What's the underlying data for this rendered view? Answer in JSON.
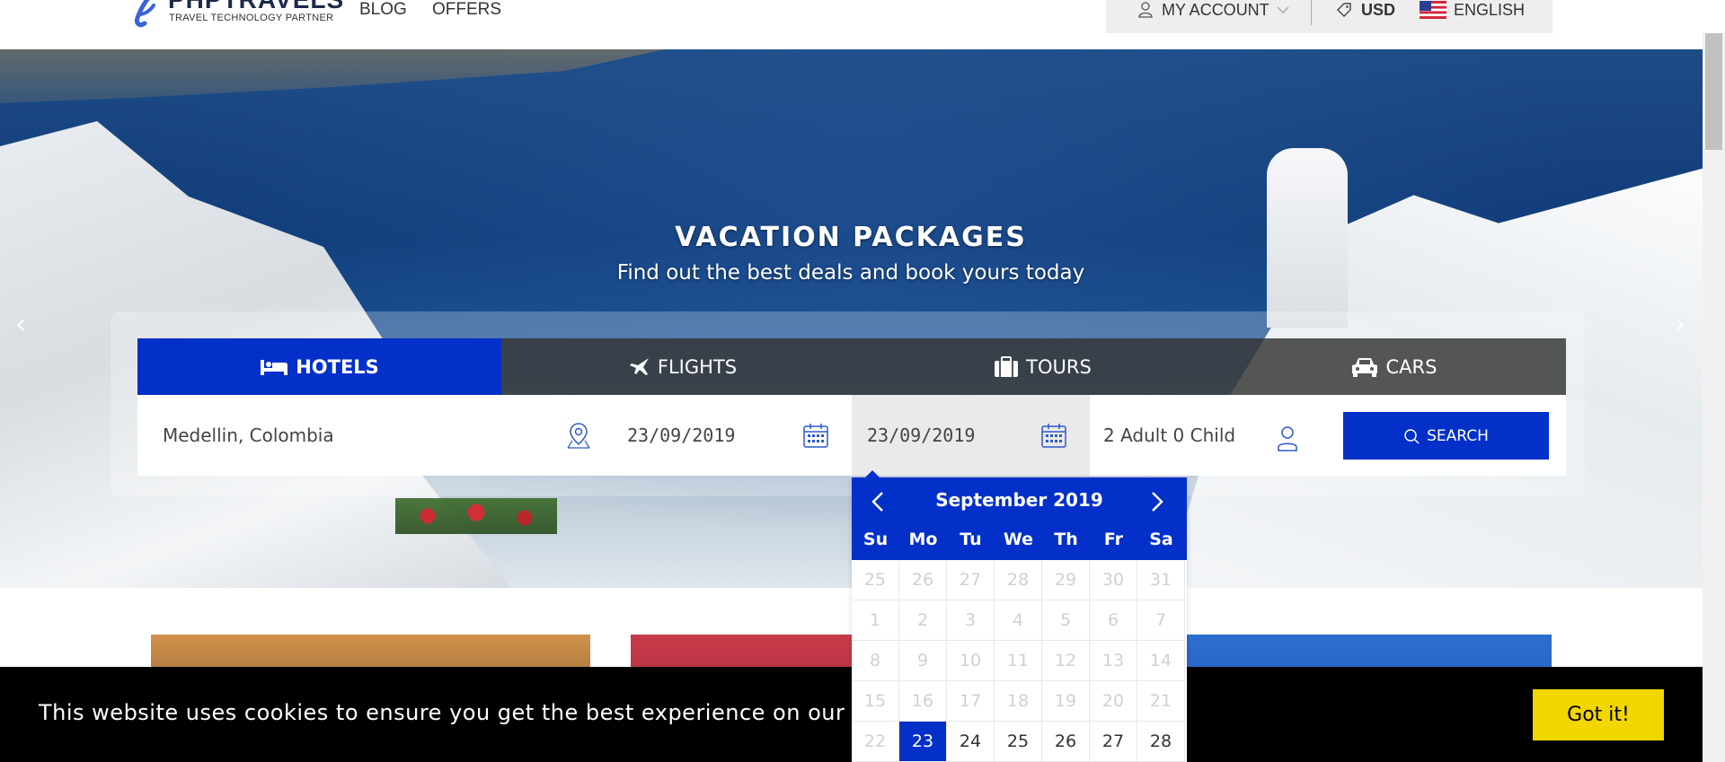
{
  "brand": {
    "name": "PHPTRAVELS",
    "tagline": "TRAVEL TECHNOLOGY PARTNER",
    "accent_color": "#0330c8"
  },
  "nav": {
    "links": [
      "BLOG",
      "OFFERS"
    ]
  },
  "account_bar": {
    "account_label": "MY ACCOUNT",
    "currency": "USD",
    "language": "ENGLISH"
  },
  "hero": {
    "title": "VACATION PACKAGES",
    "subtitle": "Find out the best deals and book yours today",
    "prev_arrow": "‹",
    "next_arrow": "›"
  },
  "search": {
    "tabs": [
      {
        "label": "HOTELS",
        "icon": "bed-icon",
        "active": true
      },
      {
        "label": "FLIGHTS",
        "icon": "plane-icon",
        "active": false
      },
      {
        "label": "TOURS",
        "icon": "suitcase-icon",
        "active": false
      },
      {
        "label": "CARS",
        "icon": "car-icon",
        "active": false
      }
    ],
    "destination": "Medellin, Colombia",
    "checkin": "23/09/2019",
    "checkout": "23/09/2019",
    "guests": "2 Adult 0 Child",
    "button_label": "SEARCH"
  },
  "datepicker": {
    "month_label": "September 2019",
    "weekdays": [
      "Su",
      "Mo",
      "Tu",
      "We",
      "Th",
      "Fr",
      "Sa"
    ],
    "rows": [
      [
        "25",
        "26",
        "27",
        "28",
        "29",
        "30",
        "31"
      ],
      [
        "1",
        "2",
        "3",
        "4",
        "5",
        "6",
        "7"
      ],
      [
        "8",
        "9",
        "10",
        "11",
        "12",
        "13",
        "14"
      ],
      [
        "15",
        "16",
        "17",
        "18",
        "19",
        "20",
        "21"
      ],
      [
        "22",
        "23",
        "24",
        "25",
        "26",
        "27",
        "28"
      ]
    ],
    "selected_day": "23"
  },
  "cookie": {
    "message": "This website uses cookies to ensure you get the best experience on our websi",
    "button_label": "Got it!",
    "button_color": "#f1d600"
  }
}
